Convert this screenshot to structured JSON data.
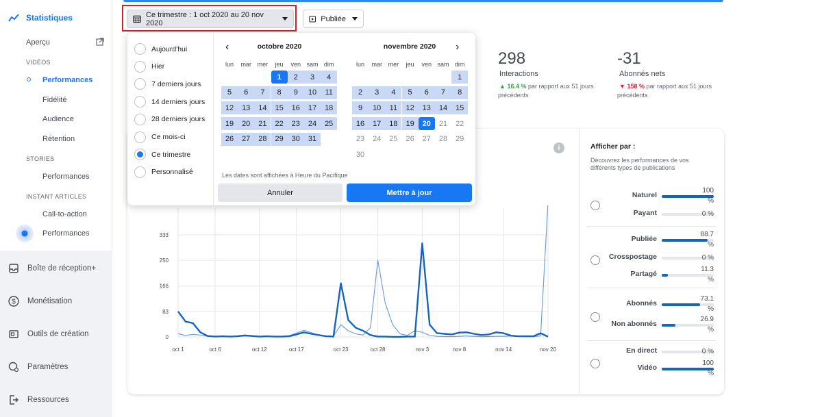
{
  "sidebar": {
    "header": "Statistiques",
    "apercu": "Aperçu",
    "sections": {
      "videos": "VIDÉOS",
      "stories": "STORIES",
      "instant": "INSTANT ARTICLES"
    },
    "videos_items": [
      "Performances",
      "Fidélité",
      "Audience",
      "Rétention"
    ],
    "stories_items": [
      "Performances"
    ],
    "instant_items": [
      "Call-to-action",
      "Performances"
    ],
    "main": [
      "Boîte de réception+",
      "Monétisation",
      "Outils de création",
      "Paramètres",
      "Ressources"
    ]
  },
  "toolbar": {
    "date_range": "Ce trimestre : 1 oct 2020 au 20 nov 2020",
    "status": "Publiée"
  },
  "metrics": [
    {
      "value": "298",
      "label": "Interactions",
      "change": "16.4 %",
      "direction": "up",
      "note_a": "par rapport aux 51 jours",
      "note_b": "précédents"
    },
    {
      "value": "-31",
      "label": "Abonnés nets",
      "change": "158 %",
      "direction": "down",
      "note_a": "par rapport aux 51 jours",
      "note_b": "précédents"
    }
  ],
  "datepicker": {
    "presets": [
      "Aujourd'hui",
      "Hier",
      "7 derniers jours",
      "14 derniers jours",
      "28 derniers jours",
      "Ce mois-ci",
      "Ce trimestre",
      "Personnalisé"
    ],
    "selected_preset": "Ce trimestre",
    "weekdays": [
      "lun",
      "mar",
      "mer",
      "jeu",
      "ven",
      "sam",
      "dim"
    ],
    "months": [
      {
        "title": "octobre 2020",
        "first_offset": 3,
        "days": 31,
        "range_from": 1,
        "range_to": 31,
        "selected": 1
      },
      {
        "title": "novembre 2020",
        "first_offset": 6,
        "days": 30,
        "range_from": 1,
        "range_to": 20,
        "selected": 20
      }
    ],
    "tz_note": "Les dates sont affichées à Heure du Pacifique",
    "cancel": "Annuler",
    "update": "Mettre à jour"
  },
  "breakdown": {
    "title": "Afficher par :",
    "desc_a": "Découvrez les performances de vos",
    "desc_b": "différents types de publications",
    "groups": [
      [
        {
          "label": "Naturel",
          "pct_a": "100",
          "pct_b": "%",
          "fill": 100
        },
        {
          "label": "Payant",
          "pct_a": "0 %",
          "pct_b": "",
          "fill": 0
        }
      ],
      [
        {
          "label": "Publiée",
          "pct_a": "88.7",
          "pct_b": "%",
          "fill": 88.7
        },
        {
          "label": "Crosspostage",
          "pct_a": "0 %",
          "pct_b": "",
          "fill": 0
        },
        {
          "label": "Partagé",
          "pct_a": "11.3",
          "pct_b": "%",
          "fill": 11.3
        }
      ],
      [
        {
          "label": "Abonnés",
          "pct_a": "73.1",
          "pct_b": "%",
          "fill": 73.1
        },
        {
          "label": "Non abonnés",
          "pct_a": "26.9",
          "pct_b": "%",
          "fill": 26.9
        }
      ],
      [
        {
          "label": "En direct",
          "pct_a": "0 %",
          "pct_b": "",
          "fill": 0
        },
        {
          "label": "Vidéo",
          "pct_a": "100",
          "pct_b": "%",
          "fill": 100
        }
      ]
    ]
  },
  "chart_data": {
    "type": "line",
    "yticks": [
      "0",
      "83",
      "166",
      "250",
      "333"
    ],
    "ylim": [
      0,
      420
    ],
    "xlabels": [
      "oct 1",
      "oct 6",
      "oct 12",
      "oct 17",
      "oct 23",
      "oct 28",
      "nov 3",
      "nov 8",
      "nov 14",
      "nov 20"
    ],
    "xtick_days": [
      0,
      5,
      11,
      16,
      22,
      27,
      33,
      38,
      44,
      50
    ],
    "series": [
      {
        "color": "#1565c0",
        "values": [
          83,
          50,
          45,
          15,
          3,
          1,
          2,
          1,
          2,
          5,
          3,
          1,
          2,
          1,
          1,
          2,
          8,
          15,
          10,
          6,
          2,
          1,
          175,
          55,
          30,
          20,
          6,
          1,
          1,
          0,
          0,
          1,
          1,
          305,
          40,
          12,
          10,
          8,
          14,
          15,
          10,
          6,
          8,
          15,
          12,
          4,
          2,
          2,
          2,
          12,
          1
        ]
      },
      {
        "color": "#6f9fd8",
        "values": [
          10,
          5,
          8,
          6,
          2,
          1,
          1,
          1,
          2,
          3,
          2,
          1,
          2,
          1,
          2,
          4,
          12,
          22,
          14,
          5,
          3,
          2,
          40,
          20,
          10,
          6,
          30,
          250,
          110,
          40,
          10,
          5,
          20,
          15,
          5,
          2,
          1,
          1,
          2,
          3,
          2,
          1,
          1,
          2,
          2,
          3,
          2,
          1,
          1,
          3,
          440
        ]
      }
    ]
  }
}
